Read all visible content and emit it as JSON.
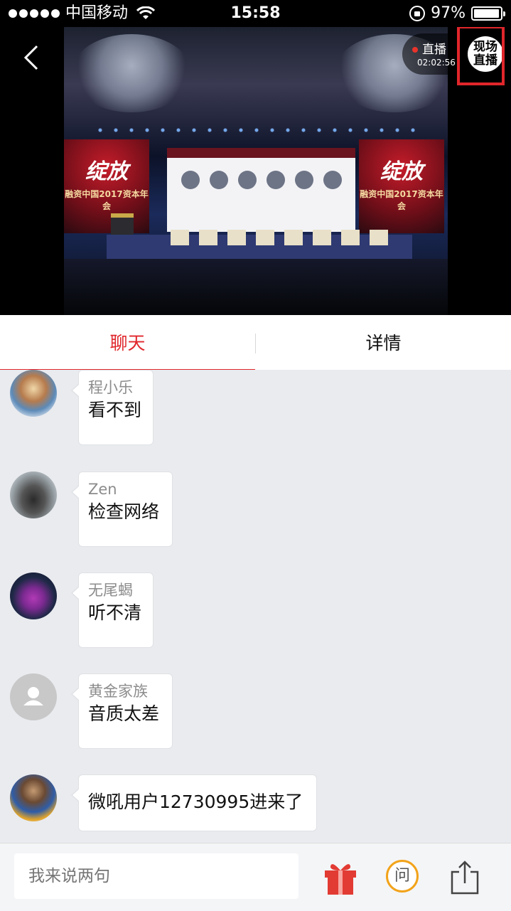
{
  "status_bar": {
    "carrier": "中国移动",
    "time": "15:58",
    "battery": "97%",
    "battery_level": 0.97
  },
  "video": {
    "live_label": "直播",
    "live_time": "02:02:56",
    "logo_text": "现场直播",
    "banner_brand": "绽放",
    "banner_sub": "融资中国2017资本年会"
  },
  "tabs": [
    {
      "label": "聊天",
      "active": true
    },
    {
      "label": "详情",
      "active": false
    }
  ],
  "messages": [
    {
      "user": "程小乐",
      "text": "看不到",
      "avatar": "avatar-chengxiaole"
    },
    {
      "user": "Zen",
      "text": "检查网络",
      "avatar": "avatar-zen"
    },
    {
      "user": "无尾蝎",
      "text": "听不清",
      "avatar": "avatar-wuweixie"
    },
    {
      "user": "黄金家族",
      "text": "音质太差",
      "avatar": "avatar-default"
    },
    {
      "user": "",
      "text": "微吼用户12730995进来了",
      "avatar": "avatar-system-user"
    }
  ],
  "input": {
    "placeholder": "我来说两句"
  },
  "bottom_actions": {
    "ask_label": "问"
  },
  "colors": {
    "accent": "#e0262b",
    "chat_bg": "#e9ebef",
    "ask_ring": "#f2a31a"
  }
}
